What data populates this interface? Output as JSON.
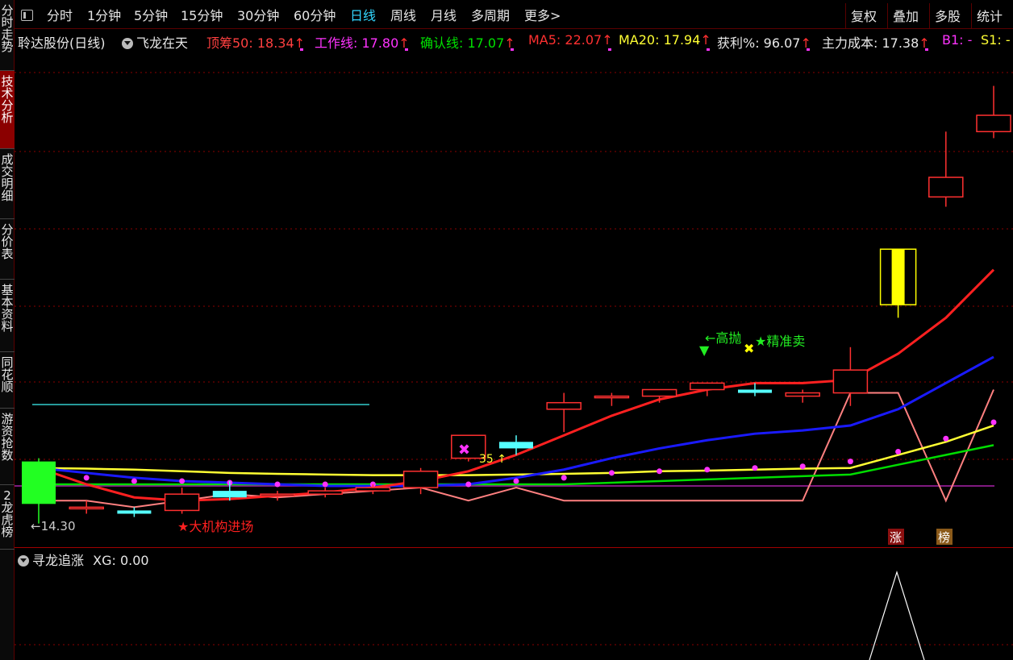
{
  "sidebar": [
    {
      "label": "分时走势",
      "active": false
    },
    {
      "label": "技术分析",
      "active": true
    },
    {
      "label": "成交明细",
      "active": false
    },
    {
      "label": "分价表",
      "active": false
    },
    {
      "label": "基本资料",
      "active": false
    },
    {
      "label": "同花顺",
      "active": false
    },
    {
      "label": "游资抢数",
      "active": false
    },
    {
      "label": "2龙虎榜",
      "active": false
    }
  ],
  "toolbar": {
    "periods": [
      "分时",
      "1分钟",
      "5分钟",
      "15分钟",
      "30分钟",
      "60分钟",
      "日线",
      "周线",
      "月线",
      "多周期",
      "更多>"
    ],
    "active_period": "日线",
    "right": [
      "复权",
      "叠加",
      "多股",
      "统计"
    ]
  },
  "info": {
    "stock": "聆达股份(日线)",
    "formula": "飞龙在天",
    "items": [
      {
        "label": "顶筹50: 18.34",
        "color": "#ff4040"
      },
      {
        "label": "工作线: 17.80",
        "color": "#ff33ff"
      },
      {
        "label": "确认线: 17.07",
        "color": "#00e000"
      },
      {
        "label": "MA5: 22.07",
        "color": "#ff3030"
      },
      {
        "label": "MA20: 17.94",
        "color": "#ffff33"
      },
      {
        "label": "获利%: 96.07",
        "color": "#e8e8e8"
      },
      {
        "label": "主力成本: 17.38",
        "color": "#e8e8e8"
      },
      {
        "label": "B1: -",
        "color": "#ff33ff"
      },
      {
        "label": "S1: -",
        "color": "#ffff33"
      }
    ]
  },
  "annotations": {
    "low_price": "←14.30",
    "institution": "★大机构进场",
    "high_throw": "←高抛",
    "precise_sell": "★精准卖",
    "mid_price": "35 ↑",
    "zhang": "涨",
    "bang": "榜"
  },
  "sub_indicator": {
    "title": "寻龙追涨",
    "value": "XG: 0.00"
  },
  "colors": {
    "up": "#ff3030",
    "down": "#55ffff",
    "ma5": "#ff2020",
    "ma10": "#1a1aff",
    "ma20": "#ffff33",
    "green_line": "#00dd00",
    "pink_line": "#ff8080",
    "purple_line": "#aa22aa",
    "dots": "#ff33ff",
    "grid": "#8b0000"
  },
  "chart_data": {
    "type": "candlestick",
    "candles": [
      {
        "o": 16.2,
        "h": 16.3,
        "l": 14.3,
        "c": 14.9
      },
      {
        "o": 14.8,
        "h": 15.0,
        "l": 14.6,
        "c": 14.8
      },
      {
        "o": 14.7,
        "h": 14.8,
        "l": 14.5,
        "c": 14.6
      },
      {
        "o": 14.7,
        "h": 15.4,
        "l": 14.6,
        "c": 15.2
      },
      {
        "o": 15.3,
        "h": 15.6,
        "l": 15.0,
        "c": 15.1
      },
      {
        "o": 15.2,
        "h": 15.3,
        "l": 15.0,
        "c": 15.2
      },
      {
        "o": 15.2,
        "h": 15.4,
        "l": 15.1,
        "c": 15.3
      },
      {
        "o": 15.3,
        "h": 15.5,
        "l": 15.2,
        "c": 15.4
      },
      {
        "o": 15.4,
        "h": 16.0,
        "l": 15.2,
        "c": 15.9
      },
      {
        "o": 16.3,
        "h": 17.0,
        "l": 16.2,
        "c": 17.0
      },
      {
        "o": 16.8,
        "h": 17.0,
        "l": 16.4,
        "c": 16.6
      },
      {
        "o": 17.8,
        "h": 18.3,
        "l": 17.1,
        "c": 18.0
      },
      {
        "o": 18.2,
        "h": 18.3,
        "l": 17.9,
        "c": 18.2
      },
      {
        "o": 18.2,
        "h": 18.4,
        "l": 18.0,
        "c": 18.4
      },
      {
        "o": 18.4,
        "h": 18.6,
        "l": 18.2,
        "c": 18.6
      },
      {
        "o": 18.4,
        "h": 18.6,
        "l": 18.2,
        "c": 18.3
      },
      {
        "o": 18.2,
        "h": 18.4,
        "l": 18.0,
        "c": 18.3
      },
      {
        "o": 18.3,
        "h": 19.7,
        "l": 17.9,
        "c": 19.0
      },
      {
        "o": 21.0,
        "h": 22.7,
        "l": 20.6,
        "c": 22.7
      },
      {
        "o": 24.3,
        "h": 26.3,
        "l": 24.0,
        "c": 24.9
      },
      {
        "o": 26.3,
        "h": 27.7,
        "l": 26.1,
        "c": 26.8
      }
    ],
    "ma5": [
      16.0,
      15.5,
      15.1,
      15.0,
      15.05,
      15.15,
      15.25,
      15.4,
      15.6,
      15.9,
      16.4,
      17.0,
      17.6,
      18.1,
      18.4,
      18.6,
      18.6,
      18.7,
      19.5,
      20.6,
      22.07
    ],
    "ma10": [
      16.0,
      15.85,
      15.7,
      15.6,
      15.55,
      15.5,
      15.45,
      15.45,
      15.45,
      15.5,
      15.7,
      15.95,
      16.3,
      16.6,
      16.85,
      17.05,
      17.15,
      17.3,
      17.8,
      18.6,
      19.4
    ],
    "ma20": [
      16.0,
      15.98,
      15.95,
      15.9,
      15.85,
      15.82,
      15.8,
      15.78,
      15.78,
      15.78,
      15.8,
      15.82,
      15.85,
      15.9,
      15.92,
      15.95,
      15.98,
      16.0,
      16.4,
      16.8,
      17.3
    ],
    "level_line": [
      15.5,
      15.5,
      15.5,
      15.5,
      15.5,
      15.5,
      15.5,
      15.5,
      15.5,
      15.5,
      15.5,
      15.5,
      15.55,
      15.6,
      15.65,
      15.7,
      15.75,
      15.8,
      16.1,
      16.4,
      16.7
    ],
    "pink_line": [
      15.0,
      15.0,
      14.8,
      15.0,
      15.2,
      15.1,
      15.2,
      15.3,
      15.4,
      15.0,
      15.4,
      15.0,
      15.0,
      15.0,
      15.0,
      15.0,
      15.0,
      18.3,
      18.3,
      15.0,
      18.4
    ],
    "dots": [
      15.8,
      15.7,
      15.6,
      15.6,
      15.55,
      15.5,
      15.5,
      15.5,
      15.5,
      15.5,
      15.6,
      15.7,
      15.85,
      15.9,
      15.95,
      16.0,
      16.05,
      16.2,
      16.5,
      16.9,
      17.4
    ],
    "purple_level": 15.45,
    "cyan_level": 17.1,
    "ylim": [
      13.6,
      28.8
    ]
  }
}
